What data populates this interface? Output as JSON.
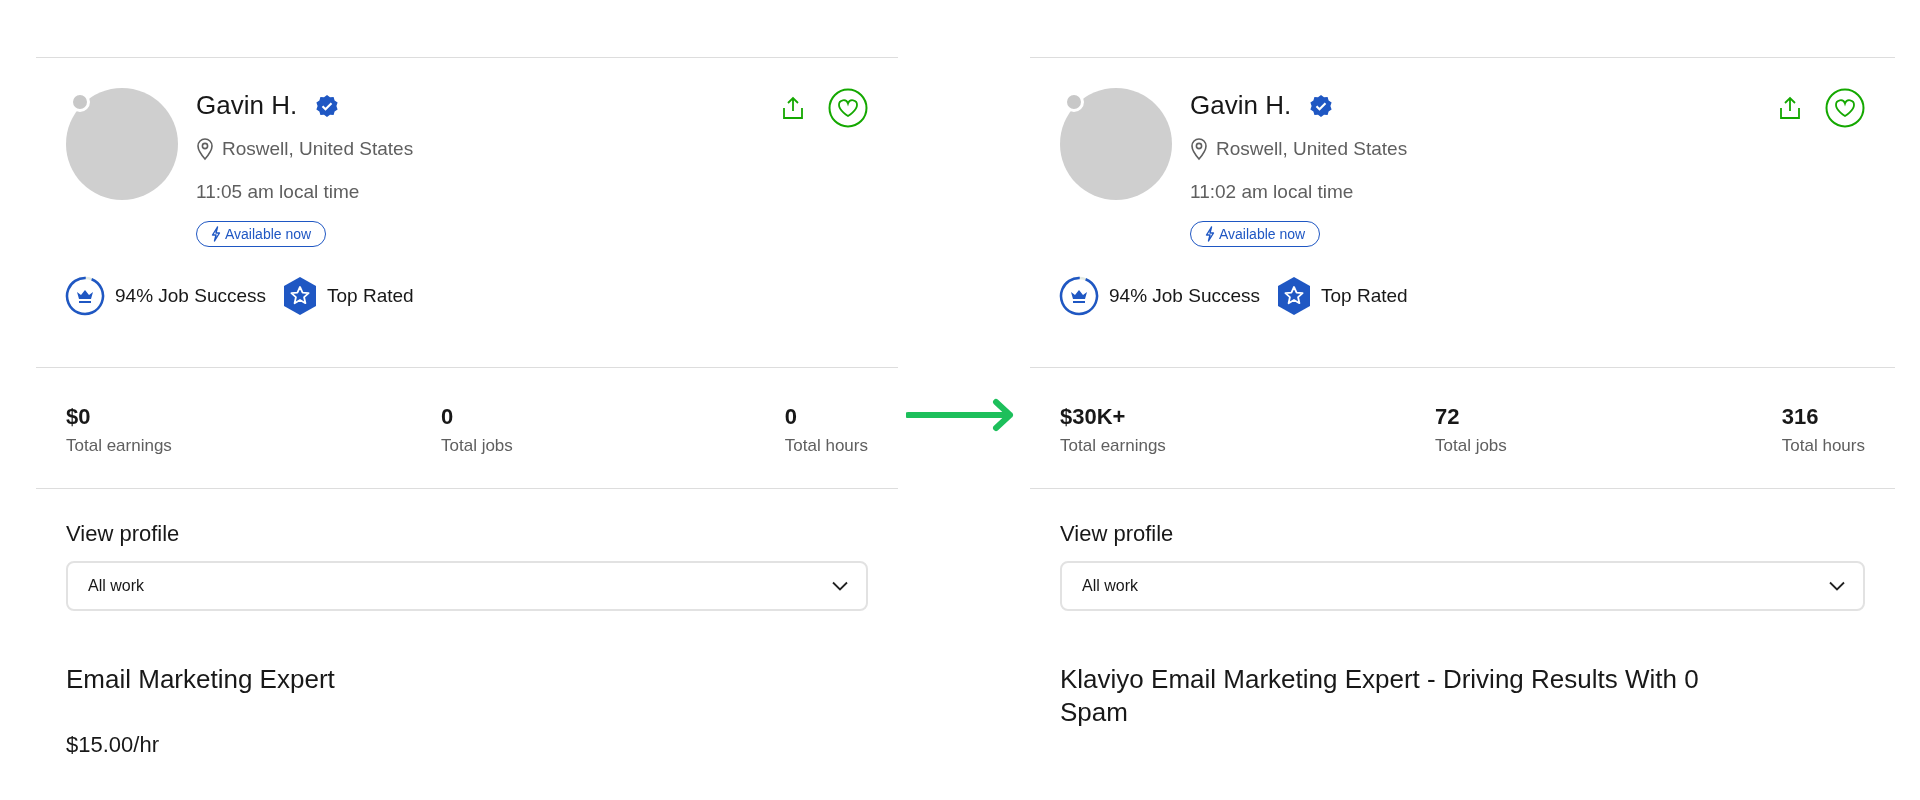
{
  "cards": [
    {
      "name": "Gavin H.",
      "location": "Roswell, United States",
      "local_time": "11:05 am local time",
      "availability": "Available now",
      "badges": [
        {
          "kind": "job_success",
          "label": "94% Job Success",
          "level": 0.94
        },
        {
          "kind": "top_rated",
          "label": "Top Rated"
        }
      ],
      "stats": [
        {
          "value": "$0",
          "label": "Total earnings"
        },
        {
          "value": "0",
          "label": "Total jobs"
        },
        {
          "value": "0",
          "label": "Total hours"
        }
      ],
      "section_title": "View profile",
      "dropdown": {
        "value": "All work"
      },
      "title": "Email Marketing Expert",
      "rate": "$15.00/hr"
    },
    {
      "name": "Gavin H.",
      "location": "Roswell, United States",
      "local_time": "11:02 am local time",
      "availability": "Available now",
      "badges": [
        {
          "kind": "job_success",
          "label": "94% Job Success",
          "level": 0.94
        },
        {
          "kind": "top_rated",
          "label": "Top Rated"
        }
      ],
      "stats": [
        {
          "value": "$30K+",
          "label": "Total earnings"
        },
        {
          "value": "72",
          "label": "Total jobs"
        },
        {
          "value": "316",
          "label": "Total hours"
        }
      ],
      "section_title": "View profile",
      "dropdown": {
        "value": "All work"
      },
      "title": "Klaviyo Email Marketing Expert - Driving Results With 0 Spam"
    }
  ]
}
